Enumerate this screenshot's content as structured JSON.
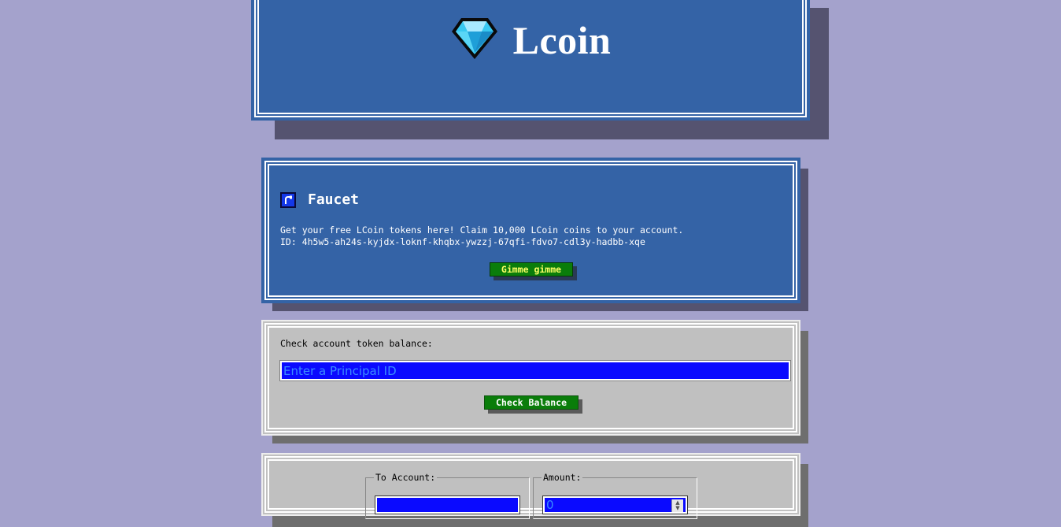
{
  "header": {
    "title": "Lcoin",
    "logo_icon": "diamond-icon"
  },
  "faucet": {
    "icon": "faucet-icon",
    "title": "Faucet",
    "description_line1": "Get your free LCoin tokens here! Claim 10,000 LCoin coins to your account.",
    "description_line2": "ID: 4h5w5-ah24s-kyjdx-loknf-khqbx-ywzzj-67qfi-fdvo7-cdl3y-hadbb-xqe",
    "button_label": "Gimme gimme"
  },
  "balance": {
    "label": "Check account token balance:",
    "input_placeholder": "Enter a Principal ID",
    "button_label": "Check Balance"
  },
  "transfer": {
    "to_account_label": "To Account:",
    "amount_label": "Amount:",
    "amount_value": "0"
  },
  "colors": {
    "background": "#a4a2cc",
    "panel_blue": "#3463a6",
    "panel_gray": "#c0c0c0",
    "button_green": "#0a7d0a",
    "input_blue": "#0a0aff"
  }
}
